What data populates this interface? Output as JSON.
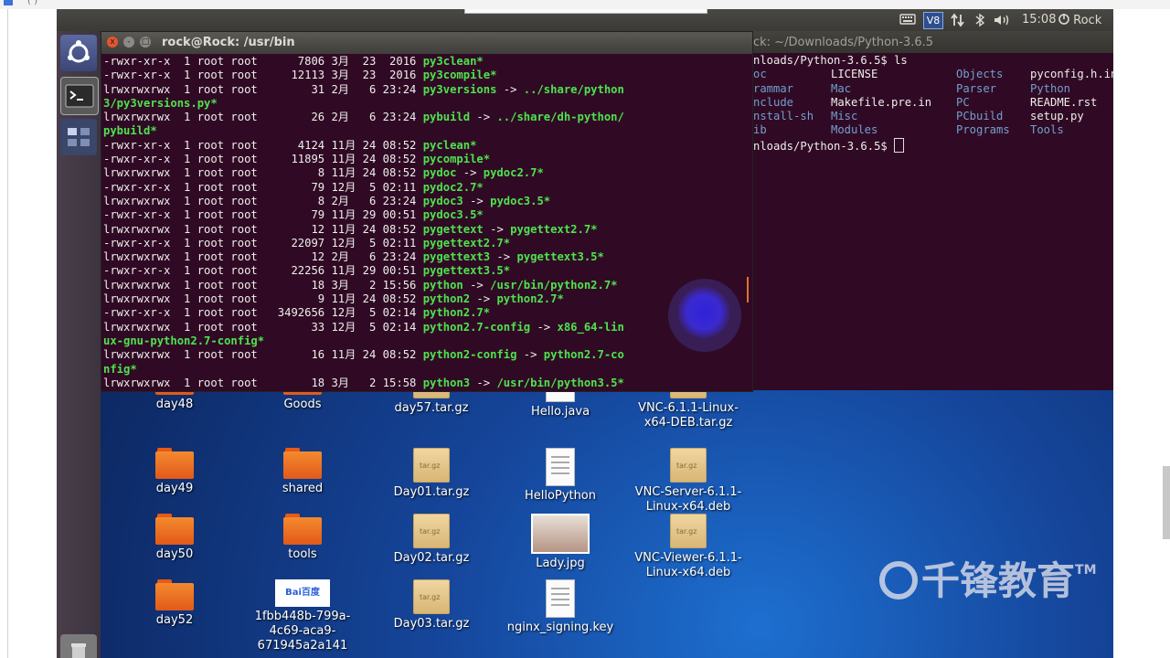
{
  "host": {
    "tab_fragment": "(   )"
  },
  "top_panel": {
    "keyboard_icon": "keyboard-icon",
    "vs_badge": "V8",
    "time": "15:08",
    "user": "Rock"
  },
  "terminal_main": {
    "title": "rock@Rock: /usr/bin",
    "close_label": "x",
    "min_label": "-",
    "max_label": "□",
    "lines": [
      {
        "perm": "-rwxr-xr-x  1 root root      7806 3月  23  2016 ",
        "name": "py3clean*",
        "rest": ""
      },
      {
        "perm": "-rwxr-xr-x  1 root root     12113 3月  23  2016 ",
        "name": "py3compile*",
        "rest": ""
      },
      {
        "perm": "lrwxrwxrwx  1 root root        31 2月   6 23:24 ",
        "name": "py3versions",
        "rest": " -> ../share/python"
      },
      {
        "perm": "",
        "name": "3/py3versions.py*",
        "rest": ""
      },
      {
        "perm": "lrwxrwxrwx  1 root root        26 2月   6 23:24 ",
        "name": "pybuild",
        "rest": " -> ../share/dh-python/"
      },
      {
        "perm": "",
        "name": "pybuild*",
        "rest": ""
      },
      {
        "perm": "-rwxr-xr-x  1 root root      4124 11月 24 08:52 ",
        "name": "pyclean*",
        "rest": ""
      },
      {
        "perm": "-rwxr-xr-x  1 root root     11895 11月 24 08:52 ",
        "name": "pycompile*",
        "rest": ""
      },
      {
        "perm": "lrwxrwxrwx  1 root root         8 11月 24 08:52 ",
        "name": "pydoc",
        "rest": " -> pydoc2.7*"
      },
      {
        "perm": "-rwxr-xr-x  1 root root        79 12月  5 02:11 ",
        "name": "pydoc2.7*",
        "rest": ""
      },
      {
        "perm": "lrwxrwxrwx  1 root root         8 2月   6 23:24 ",
        "name": "pydoc3",
        "rest": " -> pydoc3.5*"
      },
      {
        "perm": "-rwxr-xr-x  1 root root        79 11月 29 00:51 ",
        "name": "pydoc3.5*",
        "rest": ""
      },
      {
        "perm": "lrwxrwxrwx  1 root root        12 11月 24 08:52 ",
        "name": "pygettext",
        "rest": " -> pygettext2.7*"
      },
      {
        "perm": "-rwxr-xr-x  1 root root     22097 12月  5 02:11 ",
        "name": "pygettext2.7*",
        "rest": ""
      },
      {
        "perm": "lrwxrwxrwx  1 root root        12 2月   6 23:24 ",
        "name": "pygettext3",
        "rest": " -> pygettext3.5*"
      },
      {
        "perm": "-rwxr-xr-x  1 root root     22256 11月 29 00:51 ",
        "name": "pygettext3.5*",
        "rest": ""
      },
      {
        "perm": "lrwxrwxrwx  1 root root        18 3月   2 15:56 ",
        "name": "python",
        "rest": " -> /usr/bin/python2.7*"
      },
      {
        "perm": "lrwxrwxrwx  1 root root         9 11月 24 08:52 ",
        "name": "python2",
        "rest": " -> python2.7*"
      },
      {
        "perm": "-rwxr-xr-x  1 root root   3492656 12月  5 02:14 ",
        "name": "python2.7*",
        "rest": ""
      },
      {
        "perm": "lrwxrwxrwx  1 root root        33 12月  5 02:14 ",
        "name": "python2.7-config",
        "rest": " -> x86_64-lin"
      },
      {
        "perm": "",
        "name": "ux-gnu-python2.7-config*",
        "rest": ""
      },
      {
        "perm": "lrwxrwxrwx  1 root root        16 11月 24 08:52 ",
        "name": "python2-config",
        "rest": " -> python2.7-co"
      },
      {
        "perm": "",
        "name": "nfig*",
        "rest": ""
      },
      {
        "perm": "lrwxrwxrwx  1 root root        18 3月   2 15:58 ",
        "name": "python3",
        "rest": " -> /usr/bin/python3.5*"
      }
    ]
  },
  "terminal_second": {
    "title": "ck: ~/Downloads/Python-3.6.5",
    "prompt_line": "nloads/Python-3.6.5$ ls",
    "rows": [
      [
        "oc",
        "LICENSE",
        "Objects",
        "pyconfig.h.in"
      ],
      [
        "rammar",
        "Mac",
        "Parser",
        "Python"
      ],
      [
        "nclude",
        "Makefile.pre.in",
        "PC",
        "README.rst"
      ],
      [
        "nstall-sh",
        "Misc",
        "PCbuild",
        "setup.py"
      ],
      [
        "ib",
        "Modules",
        "Programs",
        "Tools"
      ]
    ],
    "prompt_after": "nloads/Python-3.6.5$ "
  },
  "desktop": {
    "icons": [
      {
        "label": "day48",
        "kind": "folder"
      },
      {
        "label": "Goods",
        "kind": "folder"
      },
      {
        "label": "day57.tar.gz",
        "kind": "box"
      },
      {
        "label": "Hello.java",
        "kind": "doc"
      },
      {
        "label": "VNC-6.1.1-Linux-x64-DEB.tar.gz",
        "kind": "box"
      },
      {
        "label": "day49",
        "kind": "folder"
      },
      {
        "label": "shared",
        "kind": "folder"
      },
      {
        "label": "Day01.tar.gz",
        "kind": "box"
      },
      {
        "label": "HelloPython",
        "kind": "doc"
      },
      {
        "label": "VNC-Server-6.1.1-Linux-x64.deb",
        "kind": "box"
      },
      {
        "label": "day50",
        "kind": "folder"
      },
      {
        "label": "tools",
        "kind": "folder"
      },
      {
        "label": "Day02.tar.gz",
        "kind": "box"
      },
      {
        "label": "Lady.jpg",
        "kind": "image"
      },
      {
        "label": "VNC-Viewer-6.1.1-Linux-x64.deb",
        "kind": "box"
      },
      {
        "label": "day52",
        "kind": "folder"
      },
      {
        "label": "1fbb448b-799a-4c69-aca9-671945a2a141",
        "kind": "image"
      },
      {
        "label": "Day03.tar.gz",
        "kind": "box"
      },
      {
        "label": "nginx_signing.key",
        "kind": "doc"
      }
    ],
    "box_tag": "tar.gz",
    "baidu_text": "Bai百度"
  },
  "watermark": {
    "text": "千锋教育",
    "tm": "TM"
  },
  "colors": {
    "terminal_bg": "#300a24",
    "terminal_fg": "#eeeeec",
    "exec_green": "#4ee34e",
    "ubuntu_panel": "#3b3a36"
  }
}
